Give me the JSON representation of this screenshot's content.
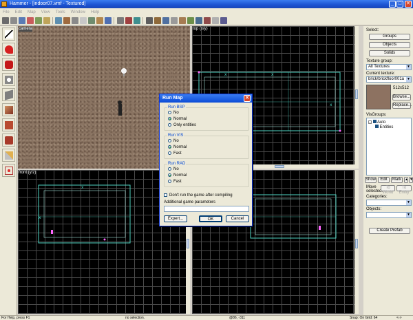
{
  "window": {
    "title": "Hammer - [indoor07.vmf - Textured]",
    "min": "_",
    "max": "□",
    "close": "✕"
  },
  "menu": [
    "File",
    "Edit",
    "Map",
    "View",
    "Tools",
    "Window",
    "Help"
  ],
  "viewports": {
    "camera": "camera",
    "top": "top (x/y)",
    "front": "front (y/z)",
    "side": ""
  },
  "select_panel": {
    "select_label": "Select:",
    "groups": "Groups",
    "objects": "Objects",
    "solids": "Solids",
    "texture_group_label": "Texture group:",
    "texture_group_value": "All Textures",
    "current_texture_label": "Current texture:",
    "current_texture_value": "brick/brickfloor001a",
    "texture_size": "512x512",
    "browse": "Browse...",
    "replace": "Replace...",
    "visgroups_label": "VisGroups:",
    "visgroup_auto": "Auto",
    "visgroup_entities": "Entities",
    "show": "Show",
    "edit": "Edit",
    "mark": "Mark",
    "move_selected_label": "Move selected:",
    "to_world": "To World",
    "to_entity": "To Entity",
    "categories_label": "Categories:",
    "objects_label": "Objects:",
    "create_prefab": "Create Prefab"
  },
  "status": {
    "help": "For Help, press F1",
    "selection": "no selection.",
    "coords": "@86, -311",
    "snap": "Snap: On Grid: 64",
    "extra": "<->"
  },
  "dialog": {
    "title": "Run Map",
    "close": "✕",
    "bsp": {
      "title": "Run BSP",
      "options": [
        "No",
        "Normal",
        "Only entities"
      ],
      "selected": 1
    },
    "vis": {
      "title": "Run VIS",
      "options": [
        "No",
        "Normal",
        "Fast"
      ],
      "selected": 1
    },
    "rad": {
      "title": "Run RAD",
      "options": [
        "No",
        "Normal",
        "Fast"
      ],
      "selected": 1
    },
    "dont_run": "Don't run the game after compiling",
    "params_label": "Additional game parameters",
    "params_value": "",
    "expert": "Expert...",
    "ok": "OK",
    "cancel": "Cancel"
  },
  "colors": {
    "wire": "#4fd6c3",
    "wire_light": "#9ee0d8",
    "vertex": "#ff66ff",
    "grid": "#4a4a4a",
    "accent": "#0a4bd6"
  }
}
